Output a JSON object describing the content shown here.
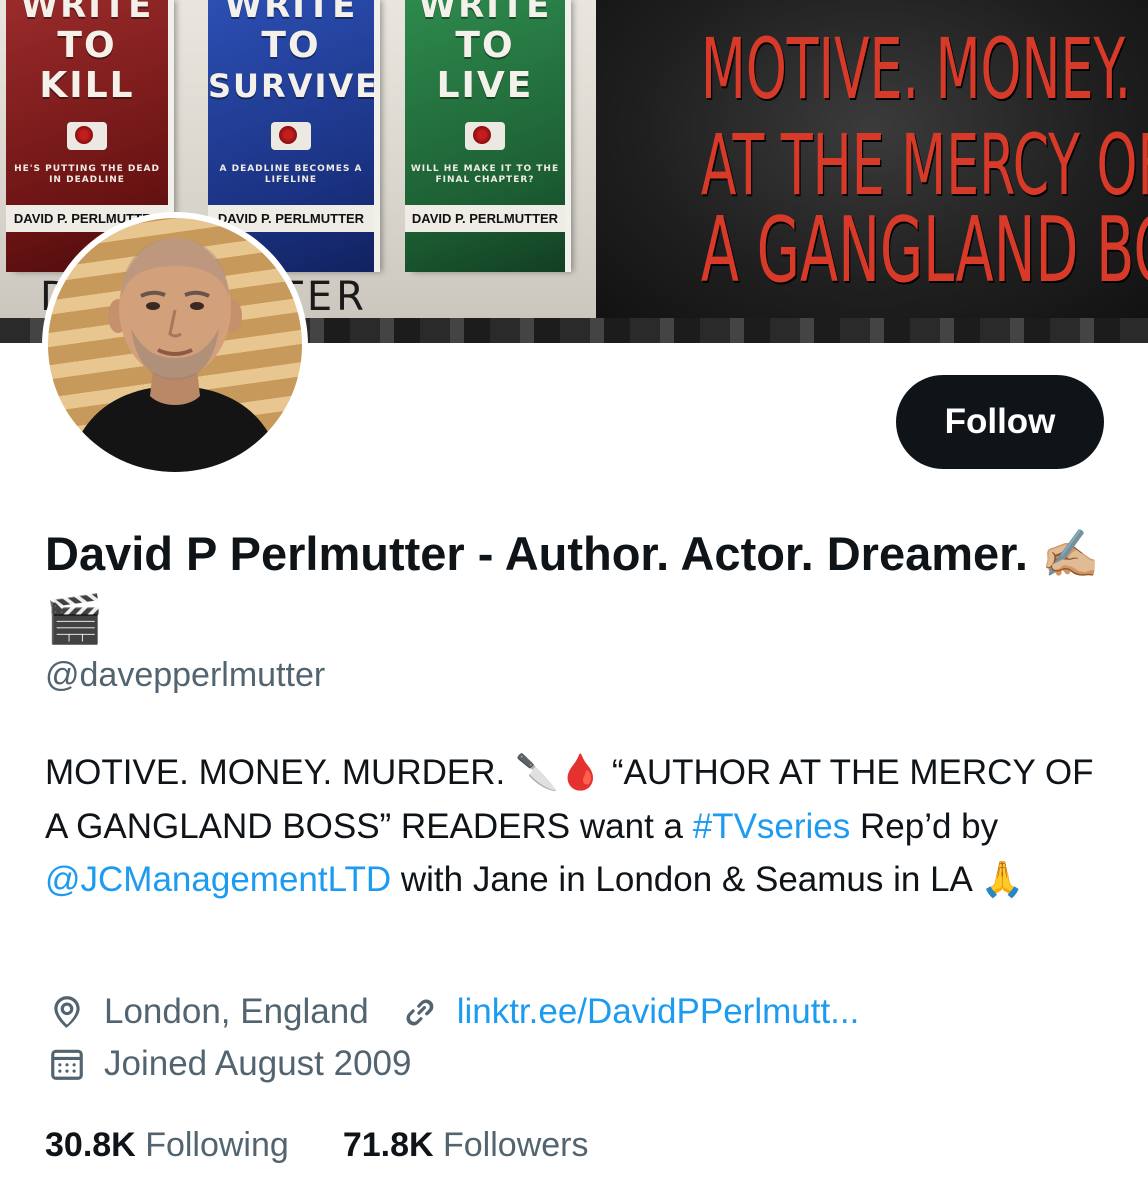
{
  "banner": {
    "books": [
      {
        "title_line1": "WRITE",
        "title_line2": "TO",
        "title_line3": "KILL",
        "tagline": "HE'S PUTTING THE DEAD IN DEADLINE",
        "author": "DAVID P. PERLMUTTER"
      },
      {
        "title_line1": "WRITE",
        "title_line2": "TO",
        "title_line3": "SURVIVE",
        "tagline": "A DEADLINE BECOMES A LIFELINE",
        "author": "DAVID P. PERLMUTTER"
      },
      {
        "title_line1": "WRITE",
        "title_line2": "TO",
        "title_line3": "LIVE",
        "tagline": "WILL HE MAKE IT TO THE FINAL CHAPTER?",
        "author": "DAVID P. PERLMUTTER"
      }
    ],
    "name_text": "D          ERLMUTTER",
    "slogan_line1": "MOTIVE. MONEY. MURDER.",
    "slogan_line2": "AT THE MERCY OF",
    "slogan_line3": "A GANGLAND BOSS"
  },
  "profile": {
    "follow_label": "Follow",
    "display_name": "David P Perlmutter - Author. Actor. Dreamer.",
    "display_name_emoji": "✍🏼🎬",
    "handle": "@davepperlmutter"
  },
  "bio": {
    "part1": "MOTIVE. MONEY. MURDER. ",
    "emoji1": "🔪🩸",
    "part2": " “AUTHOR AT THE MERCY OF A GANGLAND BOSS” READERS want a ",
    "hashtag": "#TVseries",
    "part3": " Rep’d by ",
    "mention": "@JCManagementLTD",
    "part4": " with Jane in London & Seamus in LA ",
    "emoji2": "🙏"
  },
  "meta": {
    "location": "London, England",
    "url": "linktr.ee/DavidPPerlmutt...",
    "joined": "Joined August 2009"
  },
  "stats": {
    "following_count": "30.8K",
    "following_label": "Following",
    "followers_count": "71.8K",
    "followers_label": "Followers"
  },
  "colors": {
    "text": "#0f1419",
    "secondary": "#536471",
    "link": "#1d9bf0",
    "button_bg": "#0f1419"
  }
}
